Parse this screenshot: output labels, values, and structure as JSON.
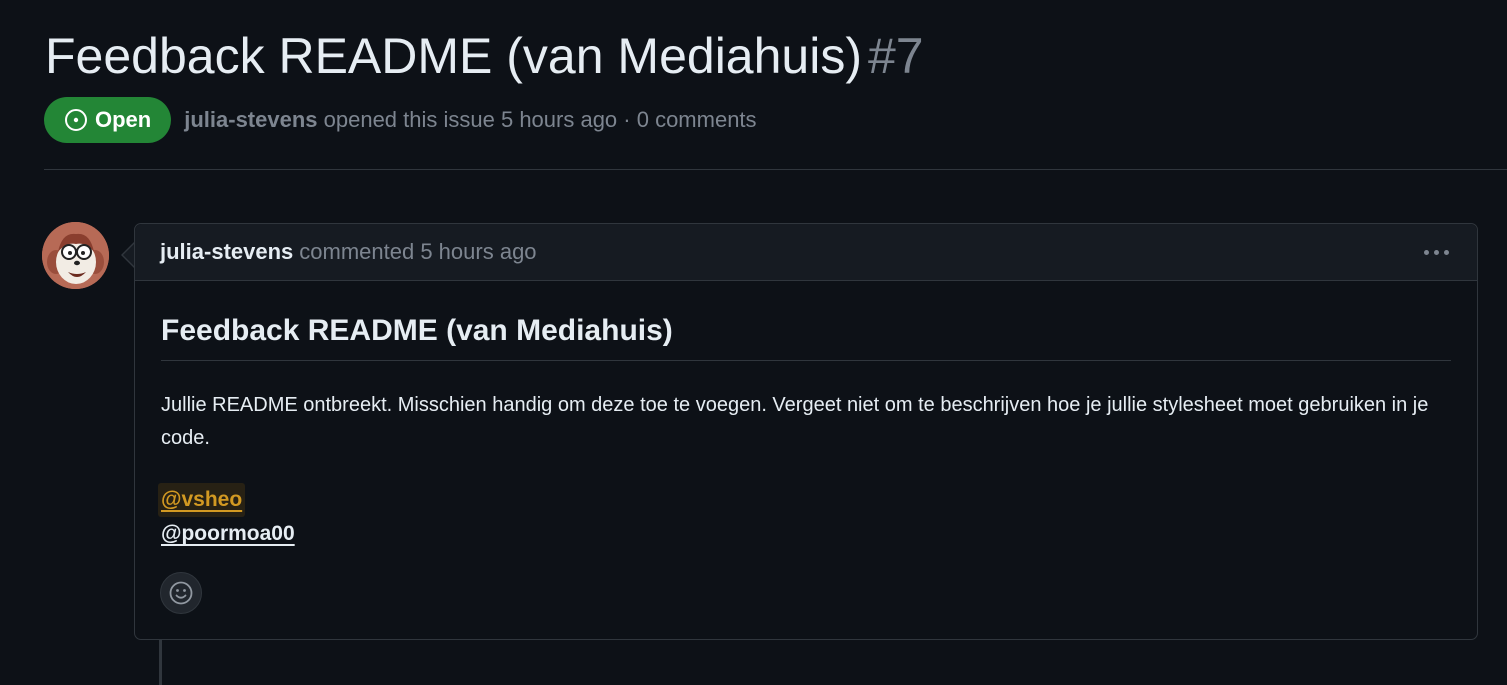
{
  "issue": {
    "title": "Feedback README (van Mediahuis)",
    "number": "#7",
    "state": "Open",
    "author": "julia-stevens",
    "opened_text": " opened this issue 5 hours ago · 0 comments"
  },
  "comment": {
    "author": "julia-stevens",
    "action": "commented 5 hours ago",
    "heading": "Feedback README (van Mediahuis)",
    "paragraph": "Jullie README ontbreekt. Misschien handig om deze toe te voegen. Vergeet niet om te beschrijven hoe je jullie stylesheet moet gebruiken in je code.",
    "mentions": [
      "@vsheo",
      "@poormoa00"
    ]
  },
  "icons": {
    "state": "issue-opened-icon",
    "more": "kebab-horizontal-icon",
    "reaction": "smiley-icon",
    "avatar": "cartoon-avatar"
  },
  "colors": {
    "background": "#0d1117",
    "open_green": "#238636",
    "mention_highlight": "#d29922",
    "border": "#30363d",
    "muted": "#7d8590"
  }
}
